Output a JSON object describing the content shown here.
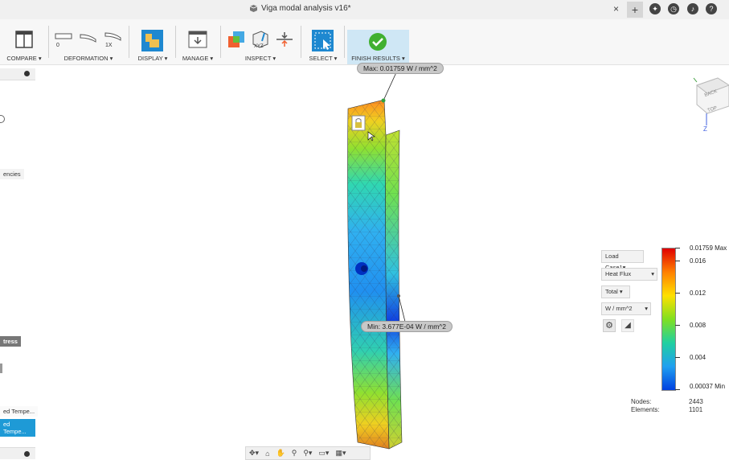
{
  "window": {
    "title": "Viga modal analysis v16*",
    "close": "×",
    "new_tab": "+"
  },
  "toolbar": {
    "compare": "COMPARE ▾",
    "deformation": "DEFORMATION ▾",
    "deform_values": [
      "0",
      "1X"
    ],
    "display": "DISPLAY ▾",
    "manage": "MANAGE ▾",
    "inspect": "INSPECT ▾",
    "inspect_icon_text": "XYZ",
    "select": "SELECT ▾",
    "finish": "FINISH RESULTS ▾"
  },
  "sidebar": {
    "frag1": "encies",
    "frag2": "tress",
    "frag3": "ed Tempe...",
    "frag4": "ed Tempe..."
  },
  "viewcube": {
    "back": "BACK",
    "top": "TOP",
    "axis_z": "Z"
  },
  "callouts": {
    "max": "Max: 0.01759 W / mm^2",
    "min": "Min: 3.677E-04 W / mm^2"
  },
  "legend": {
    "load_case": "Load Case1▾",
    "quantity": "Heat Flux",
    "component": "Total ▾",
    "unit": "W / mm^2",
    "ticks": [
      "0.01759 Max",
      "0.016",
      "0.012",
      "0.008",
      "0.004",
      "0.00037 Min"
    ],
    "colors": [
      "#e00000",
      "#ff8000",
      "#ffe000",
      "#80e020",
      "#20d0a0",
      "#20a0f0",
      "#0040e0"
    ]
  },
  "stats": {
    "nodes_label": "Nodes:",
    "nodes_value": "2443",
    "elements_label": "Elements:",
    "elements_value": "1101"
  }
}
